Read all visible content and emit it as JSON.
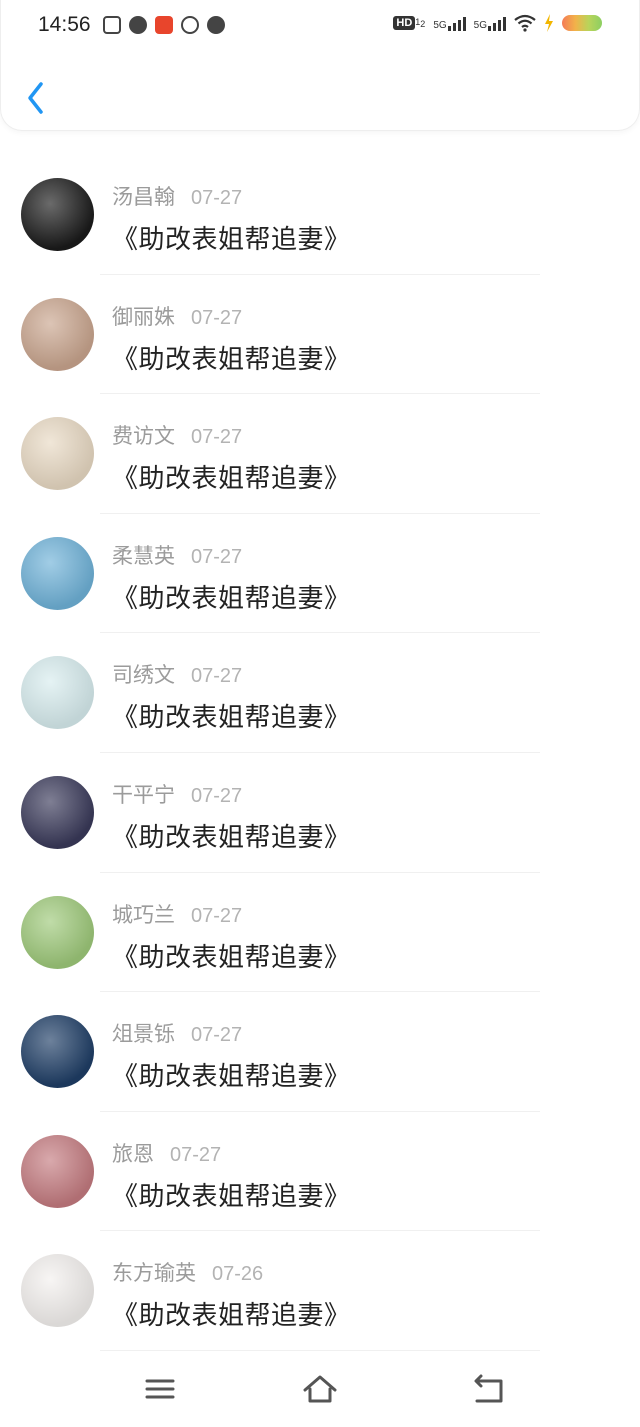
{
  "status_bar": {
    "time": "14:56",
    "network_1": "5G",
    "network_2": "5G",
    "hd_badge": "HD",
    "hd_sup": "1",
    "hd_sub": "2"
  },
  "header": {
    "back_icon": "chevron-left-icon"
  },
  "messages": [
    {
      "name": "汤昌翰",
      "date": "07-27",
      "text": "《助改表姐帮追妻》",
      "avatar_bg": "#1b1b1b"
    },
    {
      "name": "御丽姝",
      "date": "07-27",
      "text": "《助改表姐帮追妻》",
      "avatar_bg": "#c9a58e"
    },
    {
      "name": "费访文",
      "date": "07-27",
      "text": "《助改表姐帮追妻》",
      "avatar_bg": "#e8d9c3"
    },
    {
      "name": "柔慧英",
      "date": "07-27",
      "text": "《助改表姐帮追妻》",
      "avatar_bg": "#6fb2d8"
    },
    {
      "name": "司绣文",
      "date": "07-27",
      "text": "《助改表姐帮追妻》",
      "avatar_bg": "#d7ecee"
    },
    {
      "name": "干平宁",
      "date": "07-27",
      "text": "《助改表姐帮追妻》",
      "avatar_bg": "#3a3a5a"
    },
    {
      "name": "城巧兰",
      "date": "07-27",
      "text": "《助改表姐帮追妻》",
      "avatar_bg": "#9ec97a"
    },
    {
      "name": "俎景铄",
      "date": "07-27",
      "text": "《助改表姐帮追妻》",
      "avatar_bg": "#1f3e66"
    },
    {
      "name": "旅恩",
      "date": "07-27",
      "text": "《助改表姐帮追妻》",
      "avatar_bg": "#c47b80"
    },
    {
      "name": "东方瑜英",
      "date": "07-26",
      "text": "《助改表姐帮追妻》",
      "avatar_bg": "#f3f0ee"
    }
  ],
  "nav": {
    "menu_icon": "menu-icon",
    "home_icon": "home-icon",
    "back_icon": "back-icon"
  },
  "colors": {
    "accent": "#2196f3",
    "name": "#9b9b9b",
    "message": "#222222"
  }
}
